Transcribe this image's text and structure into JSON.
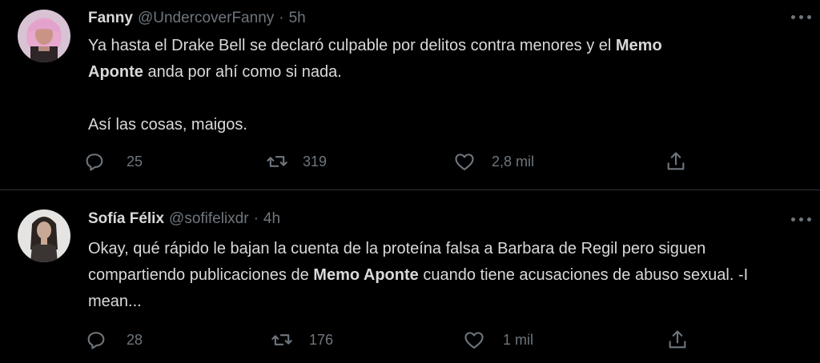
{
  "tweets": [
    {
      "name": "Fanny",
      "handle": "@UndercoverFanny",
      "separator": "·",
      "time": "5h",
      "text_line1_a": "Ya hasta el Drake Bell se declaró culpable por delitos contra menores y el ",
      "text_line1_bold": "Memo",
      "text_line2_bold": "Aponte",
      "text_line2_b": " anda por ahí como si nada.",
      "text_para2": "Así las cosas, maigos.",
      "replies": "25",
      "retweets": "319",
      "likes": "2,8 mil",
      "avatar_icon": "avatar-woman-pink-hair"
    },
    {
      "name": "Sofía Félix",
      "handle": "@sofifelixdr",
      "separator": "·",
      "time": "4h",
      "text_a": "Okay, qué rápido le bajan la cuenta de la proteína falsa a Barbara de Regil pero siguen compartiendo publicaciones de ",
      "text_bold": "Memo Aponte",
      "text_b": " cuando tiene acusaciones de abuso sexual. -I mean...",
      "replies": "28",
      "retweets": "176",
      "likes": "1 mil",
      "avatar_icon": "avatar-woman-dark-hair"
    }
  ],
  "colors": {
    "background": "#000000",
    "text": "#d9d9d9",
    "muted": "#6e767d",
    "divider": "#2f3336"
  },
  "icons": [
    "reply-icon",
    "retweet-icon",
    "like-icon",
    "share-icon",
    "more-icon"
  ]
}
